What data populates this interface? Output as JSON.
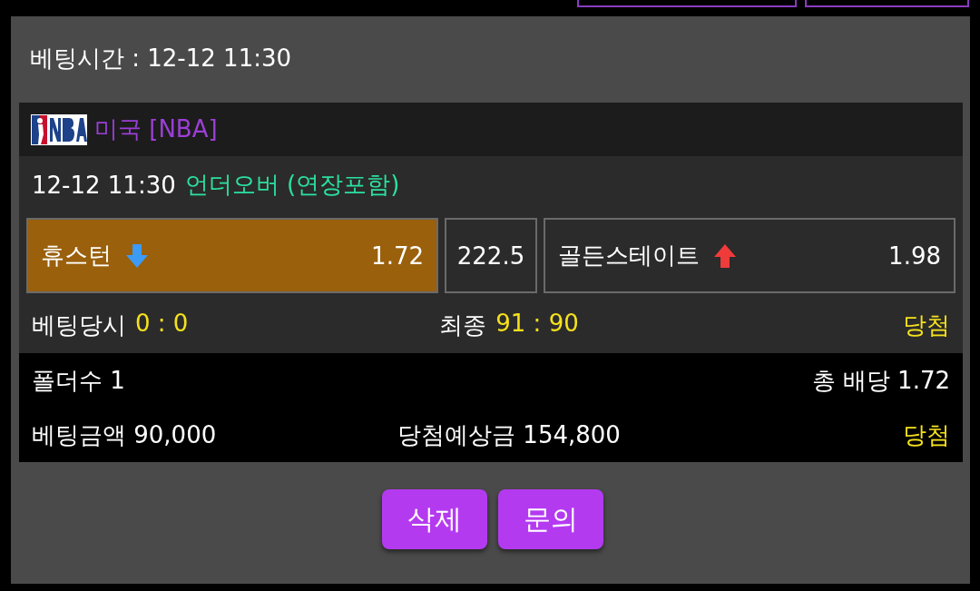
{
  "bet_time": "베팅시간 : 12-12 11:30",
  "league": {
    "name": "미국 [NBA]"
  },
  "game": {
    "datetime": "12-12 11:30",
    "market": "언더오버 (연장포함)"
  },
  "odds": [
    {
      "kind": "team",
      "name": "휴스턴",
      "rising": false,
      "price": "1.72",
      "selected": true
    },
    {
      "kind": "line",
      "value": "222.5",
      "selected": false
    },
    {
      "kind": "team",
      "name": "골든스테이트",
      "rising": true,
      "price": "1.98",
      "selected": false
    }
  ],
  "result": {
    "at_bet_label": "베팅당시",
    "at_bet_score": "0 : 0",
    "final_label": "최종",
    "final_score": "91 : 90",
    "status": "당첨"
  },
  "summary": {
    "folders": "폴더수 1",
    "total_odds": "총 배당 1.72",
    "amount": "베팅금액 90,000",
    "expected": "당첨예상금 154,800",
    "status": "당첨"
  },
  "buttons": [
    "삭제",
    "문의"
  ]
}
